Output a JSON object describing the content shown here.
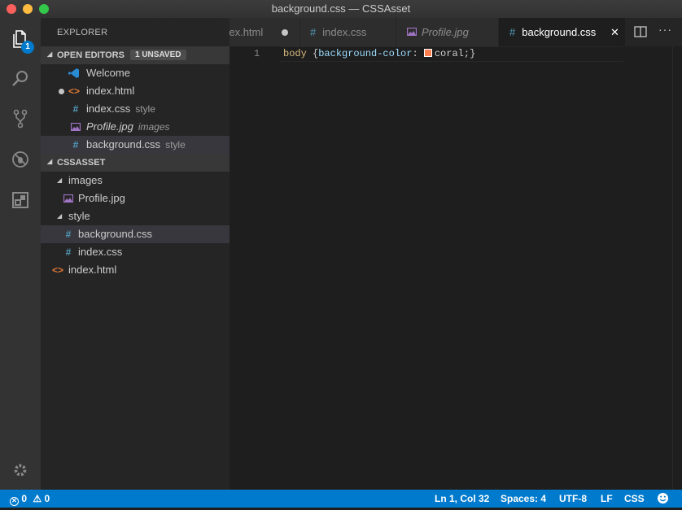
{
  "window": {
    "title": "background.css — CSSAsset"
  },
  "activity_bar": {
    "explorer_badge": "1"
  },
  "sidebar": {
    "title": "EXPLORER",
    "open_editors": {
      "header": "OPEN EDITORS",
      "badge": "1 UNSAVED",
      "items": [
        {
          "name": "Welcome",
          "desc": ""
        },
        {
          "name": "index.html",
          "desc": ""
        },
        {
          "name": "index.css",
          "desc": "style"
        },
        {
          "name": "Profile.jpg",
          "desc": "images"
        },
        {
          "name": "background.css",
          "desc": "style"
        }
      ]
    },
    "project": {
      "header": "CSSASSET",
      "folders": {
        "images": "images",
        "profile": "Profile.jpg",
        "style": "style",
        "background": "background.css",
        "index_css": "index.css",
        "index_html": "index.html"
      }
    }
  },
  "tabs": [
    {
      "label": "index.html"
    },
    {
      "label": "index.css"
    },
    {
      "label": "Profile.jpg"
    },
    {
      "label": "background.css"
    }
  ],
  "editor": {
    "line_number": "1",
    "selector": "body",
    "open_brace": " {",
    "property": "background-color",
    "colon": ": ",
    "value": "coral",
    "semicolon": ";",
    "close_brace": "}",
    "swatch_color": "#ff7f50"
  },
  "status": {
    "errors": "0",
    "warnings": "0",
    "position": "Ln 1, Col 32",
    "spaces": "Spaces: 4",
    "encoding": "UTF-8",
    "eol": "LF",
    "language": "CSS"
  },
  "colors": {
    "accent": "#007acc",
    "sidebar": "#252526",
    "editor": "#1e1e1e"
  }
}
